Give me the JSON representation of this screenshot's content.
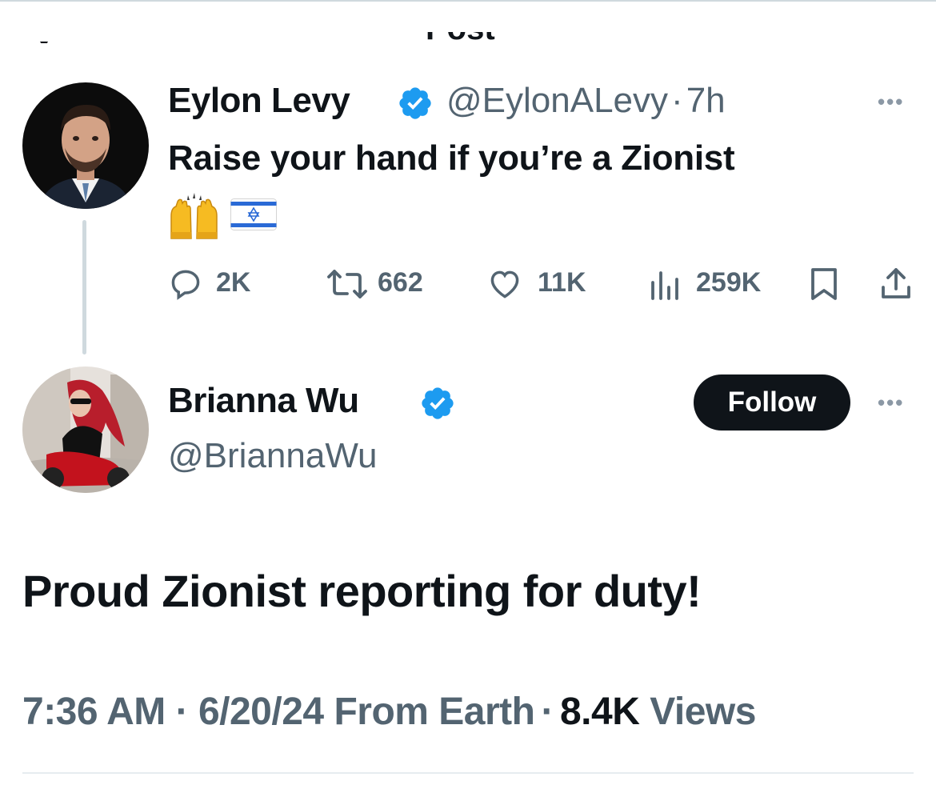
{
  "header": {
    "title": "Post"
  },
  "parent_tweet": {
    "author_name": "Eylon Levy",
    "handle": "@EylonALevy",
    "separator": "·",
    "time": "7h",
    "text": "Raise your hand if you’re a Zionist",
    "emojis": [
      "raising-hands",
      "israel-flag"
    ],
    "stats": {
      "replies": "2K",
      "reposts": "662",
      "likes": "11K",
      "views": "259K"
    }
  },
  "reply_tweet": {
    "author_name": "Brianna Wu",
    "handle": "@BriannaWu",
    "follow_label": "Follow",
    "text": "Proud Zionist reporting for duty!",
    "time": "7:36 AM",
    "date": "6/20/24",
    "source": "From Earth",
    "views_count": "8.4K",
    "views_label": "Views",
    "separator": "·"
  },
  "colors": {
    "verified": "#1d9bf0",
    "text": "#0f1419",
    "secondary": "#536471",
    "follow_bg": "#0f1419"
  }
}
